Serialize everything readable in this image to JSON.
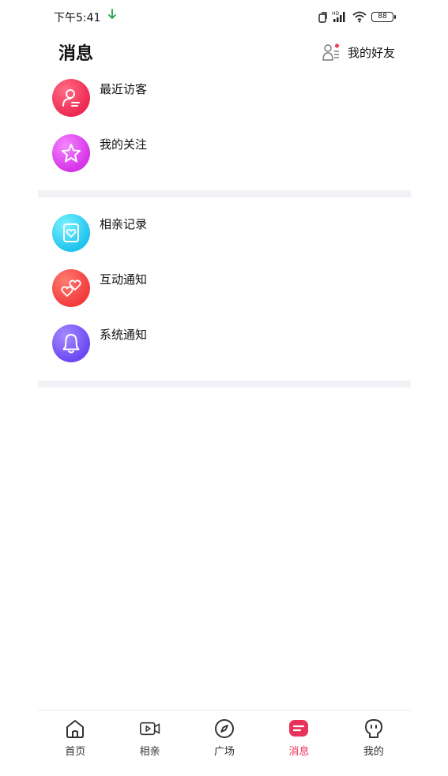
{
  "status_bar": {
    "time": "下午5:41",
    "battery": "88",
    "icons": [
      "download-arrow-icon",
      "screen-rotate-icon",
      "hd-signal-icon",
      "wifi-icon",
      "battery-icon"
    ]
  },
  "header": {
    "title": "消息",
    "friends_label": "我的好友",
    "friends_icon": "friends-icon"
  },
  "sections": [
    {
      "items": [
        {
          "label": "最近访客",
          "icon": "visitor-icon",
          "color": "#ef2a52"
        },
        {
          "label": "我的关注",
          "icon": "star-icon",
          "color": "#d634e8"
        }
      ]
    },
    {
      "items": [
        {
          "label": "相亲记录",
          "icon": "heart-card-icon",
          "color": "#1fc3ee"
        },
        {
          "label": "互动通知",
          "icon": "double-heart-icon",
          "color": "#f23c3c"
        },
        {
          "label": "系统通知",
          "icon": "bell-icon",
          "color": "#6c48f2"
        }
      ]
    }
  ],
  "bottom_nav": {
    "items": [
      {
        "label": "首页",
        "icon": "home-icon",
        "active": false
      },
      {
        "label": "相亲",
        "icon": "video-icon",
        "active": false
      },
      {
        "label": "广场",
        "icon": "compass-icon",
        "active": false
      },
      {
        "label": "消息",
        "icon": "message-icon",
        "active": true
      },
      {
        "label": "我的",
        "icon": "profile-icon",
        "active": false
      }
    ],
    "active_color": "#e8325b"
  }
}
